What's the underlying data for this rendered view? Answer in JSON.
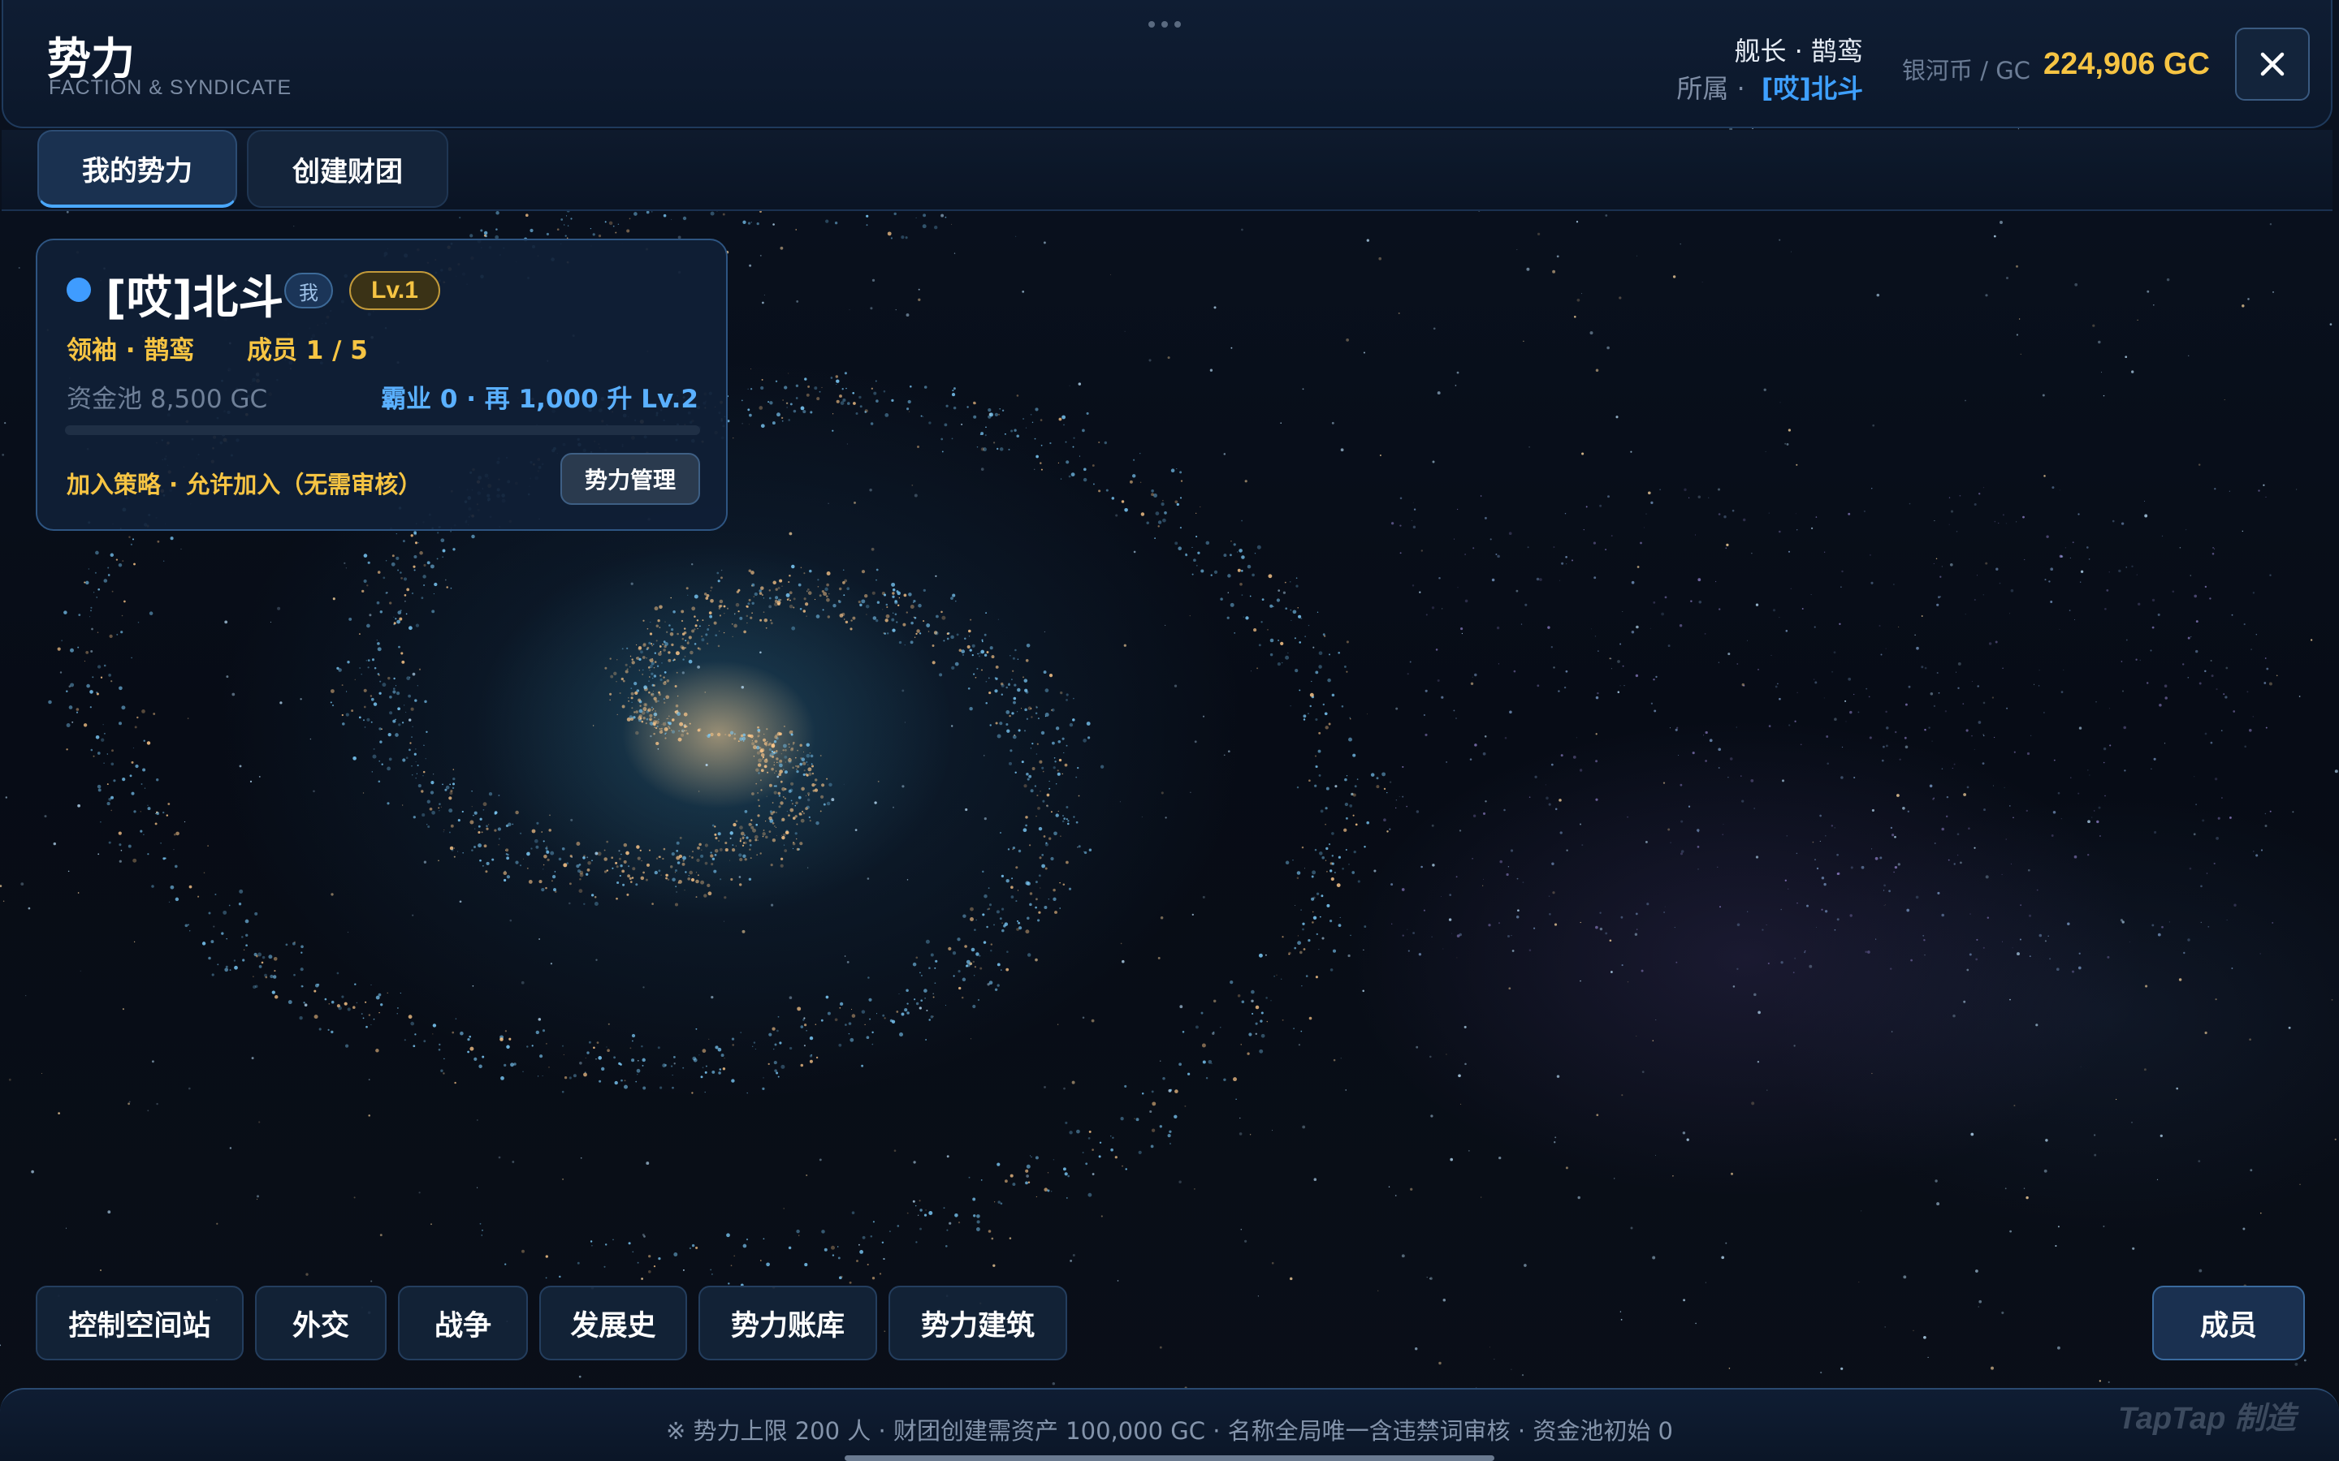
{
  "header": {
    "title": "势力",
    "subtitle": "FACTION & SYNDICATE",
    "captain_line": "舰长 · 鹊鸾",
    "affiliation_label": "所属 ·",
    "affiliation_value": "[哎]北斗",
    "currency_label": "银河币 / GC",
    "currency_value": "224,906 GC",
    "close_icon": "close-icon"
  },
  "tabs": [
    {
      "label": "我的势力",
      "active": true
    },
    {
      "label": "创建财团",
      "active": false
    }
  ],
  "faction_card": {
    "name": "[哎]北斗",
    "me_badge": "我",
    "level": "Lv.1",
    "leader": "领袖 · 鹊鸾",
    "members": "成员 1 / 5",
    "fund_pool": "资金池 8,500 GC",
    "hegemony": "霸业 0 · 再 1,000 升 Lv.2",
    "hegemony_progress": 0.0,
    "join_policy": "加入策略 · 允许加入（无需审核）",
    "manage_button": "势力管理",
    "status_color": "#3f9cff"
  },
  "actions": [
    {
      "label": "控制空间站"
    },
    {
      "label": "外交"
    },
    {
      "label": "战争"
    },
    {
      "label": "发展史"
    },
    {
      "label": "势力账库"
    },
    {
      "label": "势力建筑"
    }
  ],
  "members_button": "成员",
  "footer": {
    "notice": "※ 势力上限 200 人 · 财团创建需资产 100,000 GC · 名称全局唯一含违禁词审核 · 资金池初始 0",
    "watermark": "TapTap 制造"
  },
  "colors": {
    "accent_gold": "#f6c443",
    "accent_blue": "#3ea0ff",
    "panel_bg": "#0f1d33"
  }
}
